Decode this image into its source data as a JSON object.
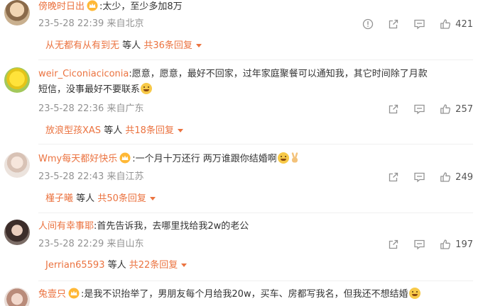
{
  "comments": [
    {
      "username": "傍晚时日出",
      "text": ":太少，至少多加8万",
      "time": "23-5-28 22:39",
      "source": "来自北京",
      "likes": "421",
      "reply_user": "从无都有从有到无",
      "reply_mid": "等人",
      "reply_count": "共36条回复"
    },
    {
      "username": "weir_Ciconiaciconia",
      "text": ":愿意，愿意，最好不回家，过年家庭聚餐可以通知我，其它时间除了月款",
      "text_line2": "短信，没事最好不要联系",
      "time": "23-5-28 22:36",
      "source": "来自广东",
      "likes": "257",
      "reply_user": "放浪型孩XAS",
      "reply_mid": "等人",
      "reply_count": "共18条回复"
    },
    {
      "username": "Wmy每天都好快乐",
      "text": ":一个月十万还行 两万谁跟你结婚啊",
      "time": "23-5-28 22:43",
      "source": "来自江苏",
      "likes": "249",
      "reply_user": "槿子曦",
      "reply_mid": "等人",
      "reply_count": "共50条回复"
    },
    {
      "username": "人间有幸事耶",
      "text": ":首先告诉我，去哪里找给我2w的老公",
      "time": "23-5-28 22:29",
      "source": "来自山东",
      "likes": "197",
      "reply_user": "Jerrian65593",
      "reply_mid": "等人",
      "reply_count": "共22条回复"
    },
    {
      "username": "兔壹只",
      "text": ":是我不识抬举了，男朋友每个月给我20w，买车、房都写我名，但我还不想结婚"
    }
  ],
  "colors": {
    "username": "#eb7340",
    "meta": "#939393",
    "text": "#333333"
  },
  "icons": [
    "vip-crown-icon",
    "report-icon",
    "share-icon",
    "comment-icon",
    "like-icon",
    "emoji-icon",
    "victory-hand-icon"
  ]
}
